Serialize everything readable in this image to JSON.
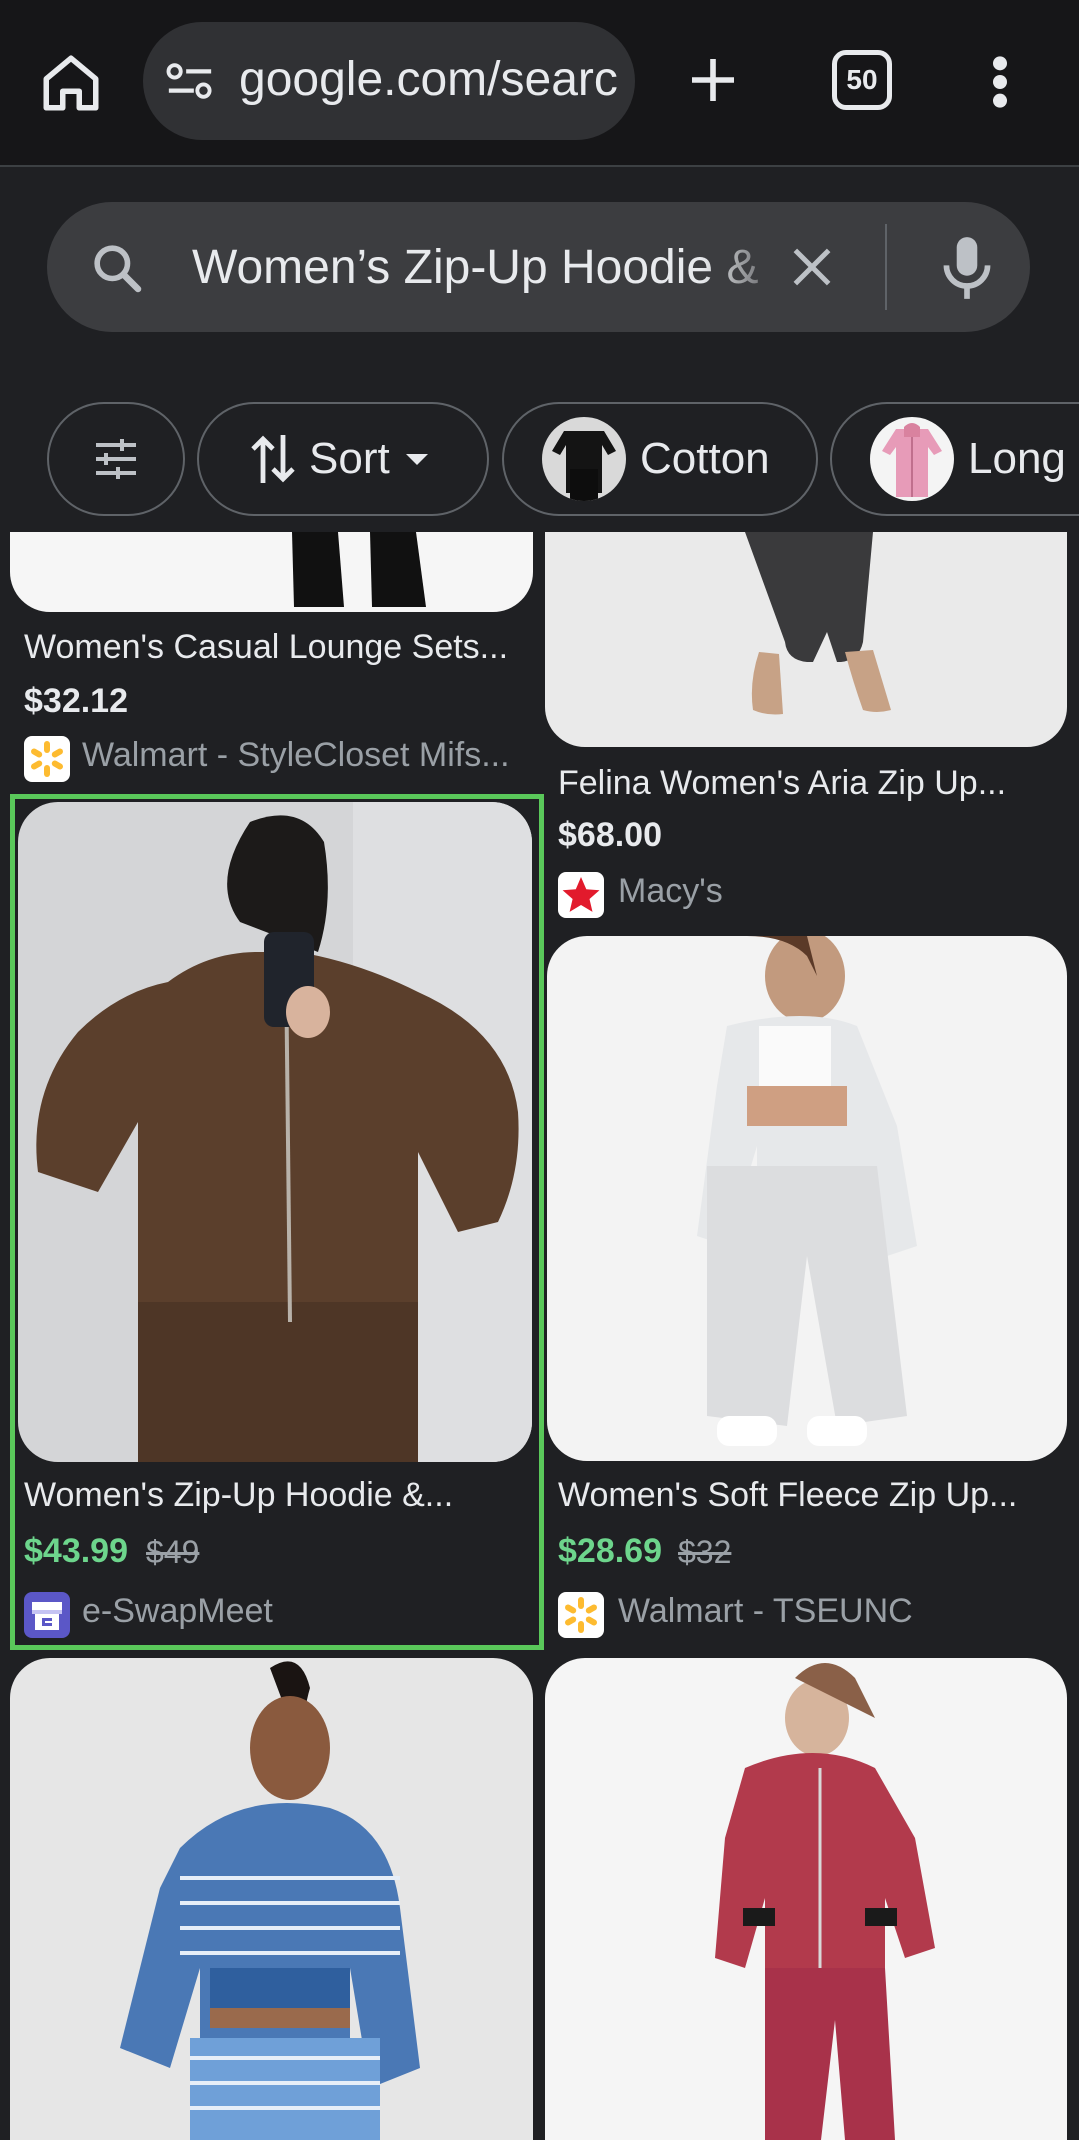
{
  "browser": {
    "url": "google.com/searc",
    "tab_count": "50"
  },
  "search": {
    "query": "Women’s Zip-Up Hoodie &"
  },
  "chips": [
    {
      "label": "Sort"
    },
    {
      "label": "Cotton"
    },
    {
      "label": "Long S"
    }
  ],
  "products": [
    {
      "title": "Women's Casual Lounge Sets...",
      "price": "$32.12",
      "store": "Walmart - StyleCloset Mifs..."
    },
    {
      "title": "Felina Women's Aria Zip Up...",
      "price": "$68.00",
      "store": "Macy's"
    },
    {
      "title": "Women's Zip-Up Hoodie &...",
      "price": "$43.99",
      "old_price": "$49",
      "store": "e-SwapMeet"
    },
    {
      "title": "Women's Soft Fleece Zip Up...",
      "price": "$28.69",
      "old_price": "$32",
      "store": "Walmart - TSEUNC"
    }
  ],
  "colors": {
    "sale_price": "#6dd58c",
    "highlight": "#5ac85a",
    "background": "#1f2023"
  }
}
